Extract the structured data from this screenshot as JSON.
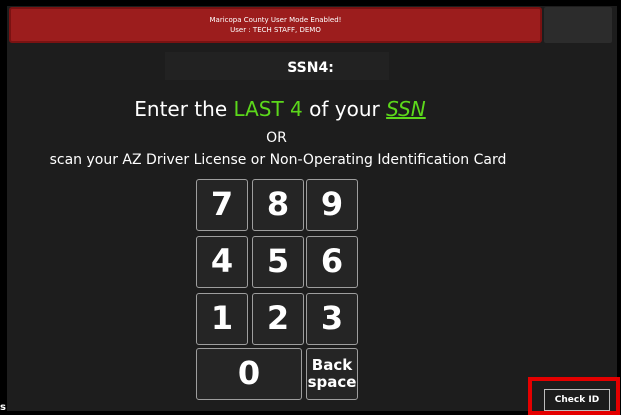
{
  "banner": {
    "line1": "Maricopa County User Mode Enabled!",
    "line2": "User : TECH STAFF, DEMO",
    "color": "#9c1d1d"
  },
  "field_label": "SSN4:",
  "prompt": {
    "pre": "Enter the ",
    "highlight": "LAST 4",
    "mid": " of your ",
    "link": "SSN"
  },
  "or_text": "OR",
  "scan_text": "scan your AZ Driver License or Non-Operating Identification Card",
  "keypad": {
    "k7": "7",
    "k8": "8",
    "k9": "9",
    "k4": "4",
    "k5": "5",
    "k6": "6",
    "k1": "1",
    "k2": "2",
    "k3": "3",
    "k0": "0",
    "back_line1": "Back",
    "back_line2": "space"
  },
  "check_id_label": "Check ID",
  "corner_mark": "s",
  "colors": {
    "accent_green": "#5cd81b",
    "highlight_red": "#e40000"
  }
}
